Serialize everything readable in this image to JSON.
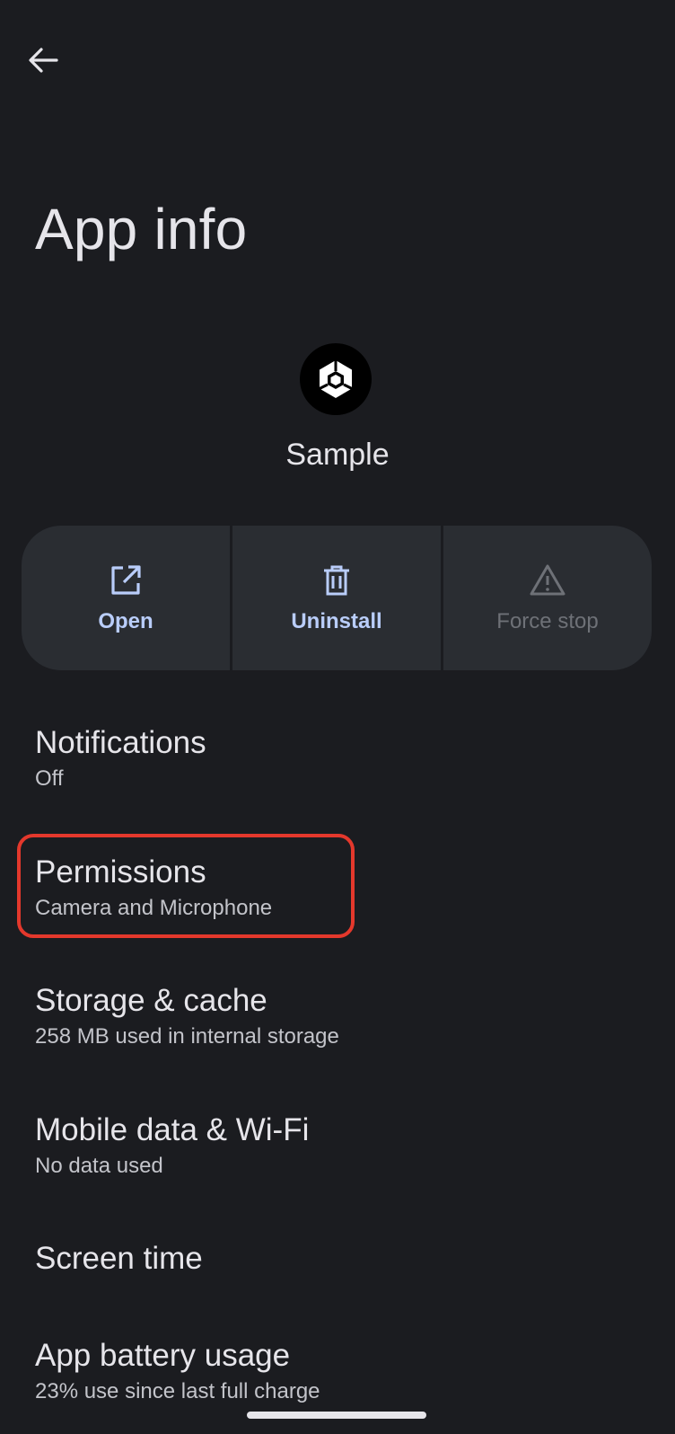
{
  "header": {
    "back_icon": "arrow-left-icon",
    "title": "App info"
  },
  "app": {
    "icon": "unity-logo-icon",
    "name": "Sample"
  },
  "actions": [
    {
      "label": "Open",
      "icon": "open-external-icon",
      "enabled": true
    },
    {
      "label": "Uninstall",
      "icon": "trash-icon",
      "enabled": true
    },
    {
      "label": "Force stop",
      "icon": "warning-icon",
      "enabled": false
    }
  ],
  "settings": [
    {
      "title": "Notifications",
      "subtitle": "Off"
    },
    {
      "title": "Permissions",
      "subtitle": "Camera and Microphone"
    },
    {
      "title": "Storage & cache",
      "subtitle": "258 MB used in internal storage"
    },
    {
      "title": "Mobile data & Wi-Fi",
      "subtitle": "No data used"
    },
    {
      "title": "Screen time",
      "subtitle": ""
    },
    {
      "title": "App battery usage",
      "subtitle": "23% use since last full charge"
    }
  ],
  "colors": {
    "background": "#1b1c20",
    "action_background": "#2a2d32",
    "action_accent": "#b9cdfa",
    "highlight": "#e4382c"
  }
}
